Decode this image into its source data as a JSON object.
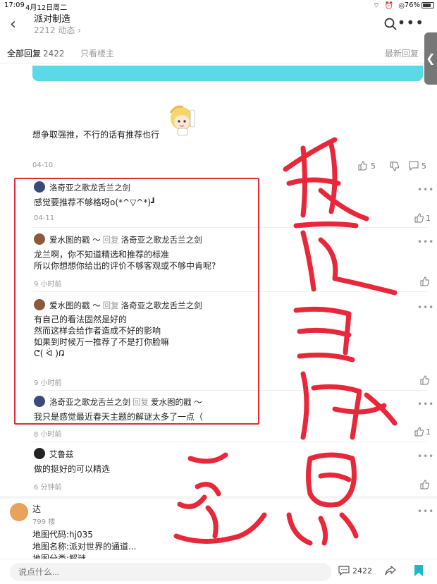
{
  "status": {
    "time": "17:09",
    "date": "4月12日周二",
    "battery": "76%",
    "battery_level": 0.76
  },
  "nav": {
    "title": "派对制造",
    "subtitle": "2212 动态 ›"
  },
  "tabs": {
    "all_label": "全部回复",
    "all_count": "2422",
    "owner_label": "只看楼主",
    "latest_label": "最新回复"
  },
  "side_tab": "❮",
  "post": {
    "text": "想争取强推，不行的话有推荐也行",
    "date": "04-10",
    "like_count": "5",
    "reply_count": "5"
  },
  "replies": [
    {
      "author": "洛奇亚之歌龙舌兰之剑",
      "reply_tag": "",
      "reply_to": "",
      "lines": [
        "感觉要推荐不够格呀o(*^▽^*)┛"
      ],
      "time": "04-11",
      "likes": "1"
    },
    {
      "author": "爱水图的戳 ～",
      "reply_tag": "回复",
      "reply_to": "洛奇亚之歌龙舌兰之剑",
      "lines": [
        "龙兰啊，你不知道精选和推荐的标准",
        "所以你想想你给出的评价不够客观或不够中肯呢?"
      ],
      "time": "9 小时前",
      "likes": ""
    },
    {
      "author": "爱水图的戳 ～",
      "reply_tag": "回复",
      "reply_to": "洛奇亚之歌龙舌兰之剑",
      "lines": [
        "有自己的看法固然是好的",
        "然而这样会给作者造成不好的影响",
        "如果到时候万一推荐了不是打你脸嘛",
        "ᕦ( ᐛ )ᕡ"
      ],
      "time": "9 小时前",
      "likes": ""
    },
    {
      "author": "洛奇亚之歌龙舌兰之剑",
      "reply_tag": "回复",
      "reply_to": "爱水图的戳 ～",
      "lines": [
        "我只是感觉最近春天主题的解谜太多了一点（"
      ],
      "time": "8 小时前",
      "likes": "1"
    },
    {
      "author": "艾鲁兹",
      "reply_tag": "",
      "reply_to": "",
      "lines": [
        "做的挺好的可以精选"
      ],
      "time": "6 分钟前",
      "likes": ""
    }
  ],
  "next_post": {
    "author": "达",
    "floor": "799 楼",
    "lines": [
      "地图代码:hj035",
      "地图名称:派对世界的通道...",
      "地图分类:解谜"
    ]
  },
  "bottom": {
    "placeholder": "说点什么...",
    "comment_count": "2422"
  },
  "colors": {
    "accent": "#1fb8c9",
    "annotation_red": "#e8283a",
    "banner_cyan": "#5ad9e6"
  }
}
